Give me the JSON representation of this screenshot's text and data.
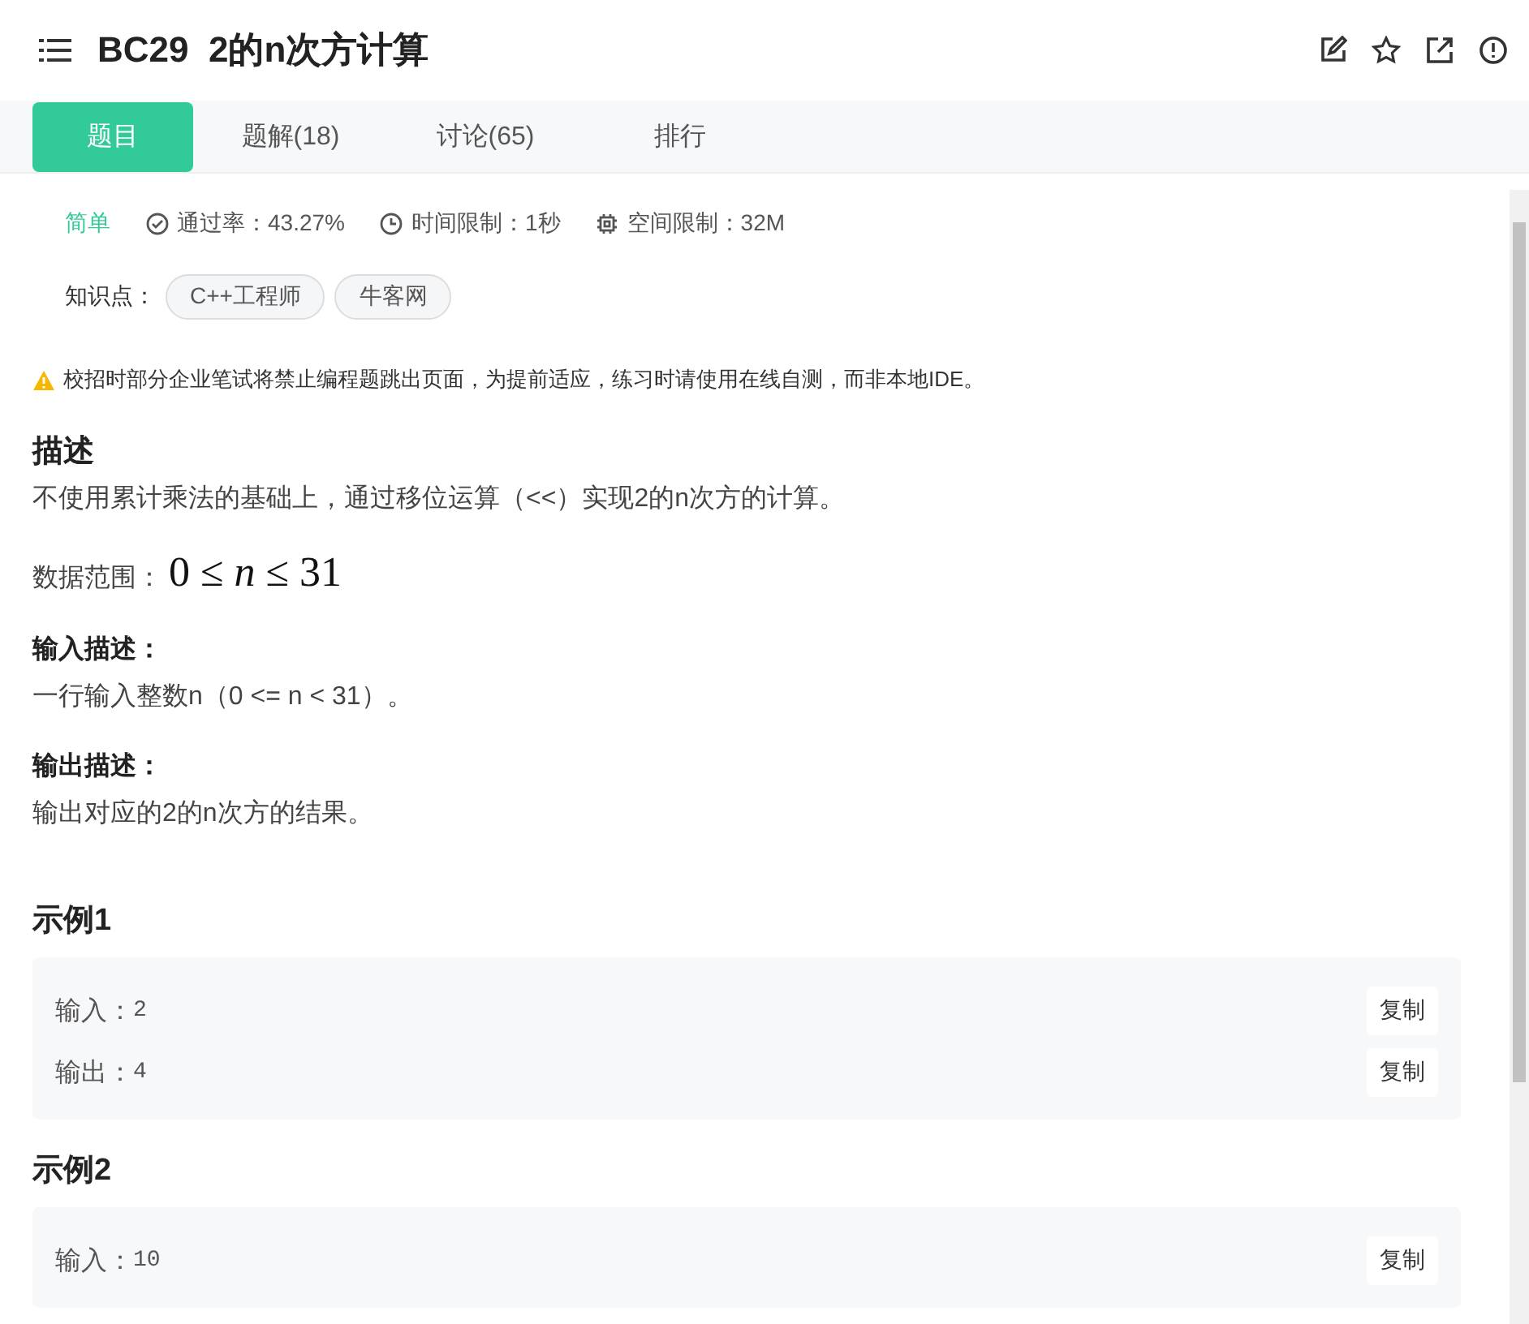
{
  "header": {
    "title": "BC29  2的n次方计算"
  },
  "tabs": [
    {
      "label": "题目",
      "selected": true
    },
    {
      "label": "题解(18)",
      "selected": false
    },
    {
      "label": "讨论(65)",
      "selected": false
    },
    {
      "label": "排行",
      "selected": false
    }
  ],
  "meta": {
    "difficulty": "简单",
    "pass_rate": "通过率：43.27%",
    "time_limit": "时间限制：1秒",
    "memory_limit": "空间限制：32M"
  },
  "knowledge": {
    "label": "知识点：",
    "tags": [
      "C++工程师",
      "牛客网"
    ]
  },
  "notice": "校招时部分企业笔试将禁止编程题跳出页面，为提前适应，练习时请使用在线自测，而非本地IDE。",
  "sections": [
    {
      "kind": "description",
      "heading": "描述",
      "text": "不使用累计乘法的基础上，通过移位运算（<<）实现2的n次方的计算。",
      "range_label": "数据范围：",
      "range_formula": "0 ≤ *n* ≤ 31"
    },
    {
      "kind": "sub",
      "heading": "输入描述：",
      "text": "一行输入整数n（0 <= n < 31）。"
    },
    {
      "kind": "sub",
      "heading": "输出描述：",
      "text": "输出对应的2的n次方的结果。"
    }
  ],
  "examples": [
    {
      "heading": "示例1",
      "rows": [
        {
          "label": "输入：",
          "value": "2",
          "copy": "复制"
        },
        {
          "label": "输出：",
          "value": "4",
          "copy": "复制"
        }
      ]
    },
    {
      "heading": "示例2",
      "rows": [
        {
          "label": "输入：",
          "value": "10",
          "copy": "复制"
        }
      ]
    }
  ]
}
